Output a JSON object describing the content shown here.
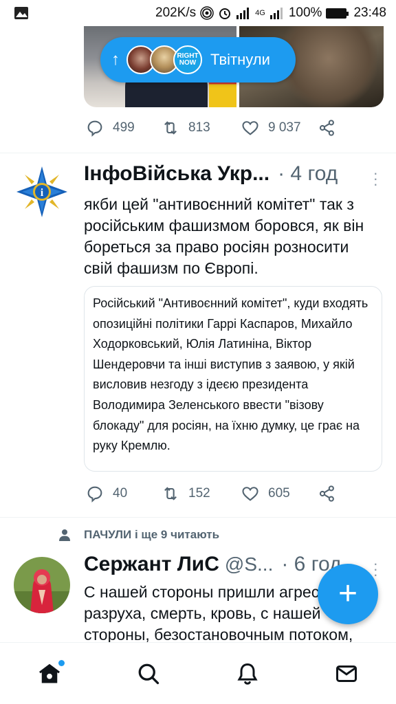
{
  "status_bar": {
    "speed": "202K/s",
    "network": "4G",
    "battery": "100%",
    "time": "23:48",
    "icons": [
      "image-icon",
      "hotspot-icon",
      "alarm-icon",
      "signal-icon",
      "battery-icon"
    ]
  },
  "tweet1": {
    "retweeters_label": "Твітнули",
    "mini_avatar_text": "RIGHT NOW",
    "stats": {
      "replies": "499",
      "retweets": "813",
      "likes": "9 037"
    }
  },
  "tweet2": {
    "name": "ІнфоВійська Укр...",
    "time": "· 4 год",
    "text": "якби цей \"антивоєнний комітет\" так з російським фашизмом боровся, як він бореться за право росіян розносити свій фашизм по Європі.",
    "quote": "Російський \"Антивоєнний комітет\", куди входять опозиційні політики Гаррі Каспаров, Михайло Ходорковський, Юлія Латиніна, Віктор Шендеровчи та інші виступив з заявою, у якій висловив незгоду з ідеєю президента Володимира Зеленського ввести \"візову блокаду\" для росіян, на їхню думку, це грає на руку Кремлю.",
    "stats": {
      "replies": "40",
      "retweets": "152",
      "likes": "605"
    }
  },
  "tweet3": {
    "social_context": "ПАЧУЛИ і ще 9 читають",
    "name": "Сержант ЛиС",
    "handle": "@S...",
    "time": "· 6 год",
    "text": "С нашей стороны пришли агрессия, разруха, смерть, кровь, с нашей стороны, безостановочным потоком,"
  },
  "colors": {
    "accent": "#1d9bf0",
    "secondary_text": "#536471"
  }
}
